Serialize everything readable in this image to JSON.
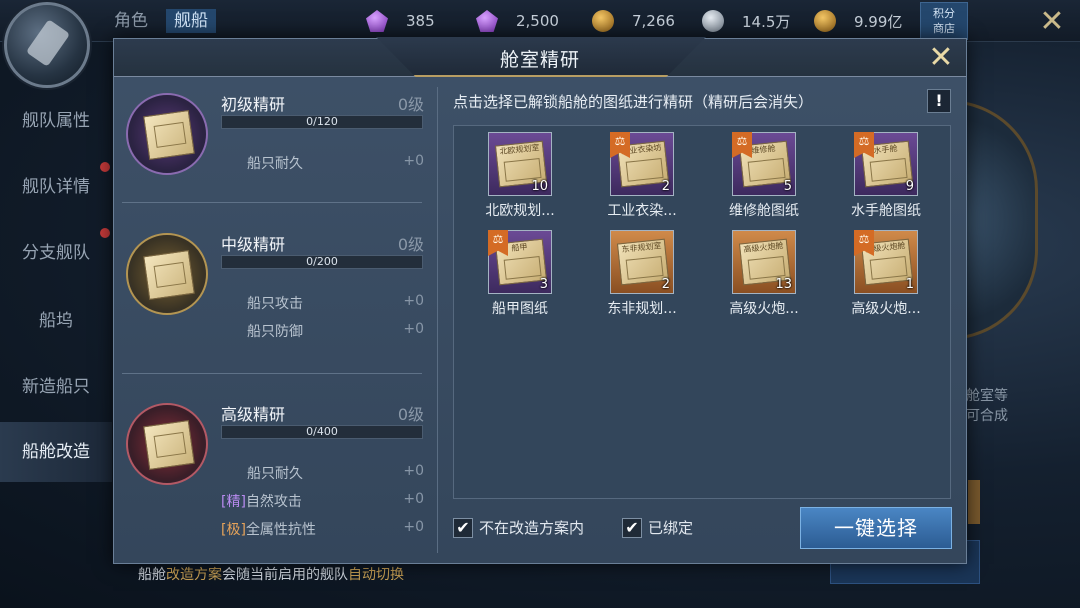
{
  "topbar": {
    "tabs": [
      {
        "label": "角色",
        "active": false
      },
      {
        "label": "舰船",
        "active": true
      }
    ],
    "resources": [
      {
        "icon": "purple-gem-icon",
        "value": "385"
      },
      {
        "icon": "purple-gem-icon",
        "value": "2,500"
      },
      {
        "icon": "gold-coin-icon",
        "value": "7,266"
      },
      {
        "icon": "silver-coin-icon",
        "value": "14.5万"
      },
      {
        "icon": "gold-coin-icon",
        "value": "9.99亿"
      }
    ],
    "shop_label": "积分\n商店"
  },
  "sidebar": {
    "items": [
      {
        "label": "舰队属性"
      },
      {
        "label": "舰队详情"
      },
      {
        "label": "分支舰队"
      },
      {
        "label": "船坞"
      },
      {
        "label": "新造船只"
      },
      {
        "label": "船舱改造"
      }
    ]
  },
  "background": {
    "side_text_1": "舱室等",
    "side_text_2": "可合成",
    "bottom_note_prefix": "船舱",
    "bottom_note_hl1": "改造方案",
    "bottom_note_mid": "会随当前启用的舰队",
    "bottom_note_hl2": "自动切换"
  },
  "dialog": {
    "title": "舱室精研",
    "tiers": [
      {
        "name": "初级精研",
        "level": "0级",
        "progress_text": "0/120",
        "progress": 0,
        "stats": [
          {
            "tag": "",
            "name": "船只耐久",
            "value": "+0"
          }
        ]
      },
      {
        "name": "中级精研",
        "level": "0级",
        "progress_text": "0/200",
        "progress": 0,
        "stats": [
          {
            "tag": "",
            "name": "船只攻击",
            "value": "+0"
          },
          {
            "tag": "",
            "name": "船只防御",
            "value": "+0"
          }
        ]
      },
      {
        "name": "高级精研",
        "level": "0级",
        "progress_text": "0/400",
        "progress": 0,
        "stats": [
          {
            "tag": "",
            "name": "船只耐久",
            "value": "+0"
          },
          {
            "tag": "[精]",
            "name": "自然攻击",
            "value": "+0"
          },
          {
            "tag": "[极]",
            "name": "全属性抗性",
            "value": "+0"
          }
        ]
      }
    ],
    "instruction": "点击选择已解锁船舱的图纸进行精研（精研后会消失）",
    "info_label": "!",
    "blueprints": [
      {
        "name": "北欧规划...",
        "count": "10",
        "rarity": "purple",
        "badge": false,
        "paper_text": "北欧规划室"
      },
      {
        "name": "工业衣染...",
        "count": "2",
        "rarity": "purple",
        "badge": true,
        "paper_text": "工业衣染坊"
      },
      {
        "name": "维修舱图纸",
        "count": "5",
        "rarity": "purple",
        "badge": true,
        "paper_text": "维修舱"
      },
      {
        "name": "水手舱图纸",
        "count": "9",
        "rarity": "purple",
        "badge": true,
        "paper_text": "水手舱"
      },
      {
        "name": "船甲图纸",
        "count": "3",
        "rarity": "purple",
        "badge": true,
        "paper_text": "船甲"
      },
      {
        "name": "东非规划...",
        "count": "2",
        "rarity": "orange",
        "badge": false,
        "paper_text": "东非规划室"
      },
      {
        "name": "高级火炮...",
        "count": "13",
        "rarity": "orange",
        "badge": false,
        "paper_text": "高级火炮舱"
      },
      {
        "name": "高级火炮...",
        "count": "1",
        "rarity": "orange",
        "badge": true,
        "paper_text": "高级火炮舱"
      }
    ],
    "badge_symbol": "⚖",
    "checkboxes": [
      {
        "label": "不在改造方案内",
        "checked": true
      },
      {
        "label": "已绑定",
        "checked": true
      }
    ],
    "select_button": "一键选择"
  },
  "colors": {
    "accent_blue": "#3a74b0",
    "gold_trim": "#b89e62",
    "purple_tag": "#b98bf0",
    "orange_tag": "#e6a35a"
  }
}
